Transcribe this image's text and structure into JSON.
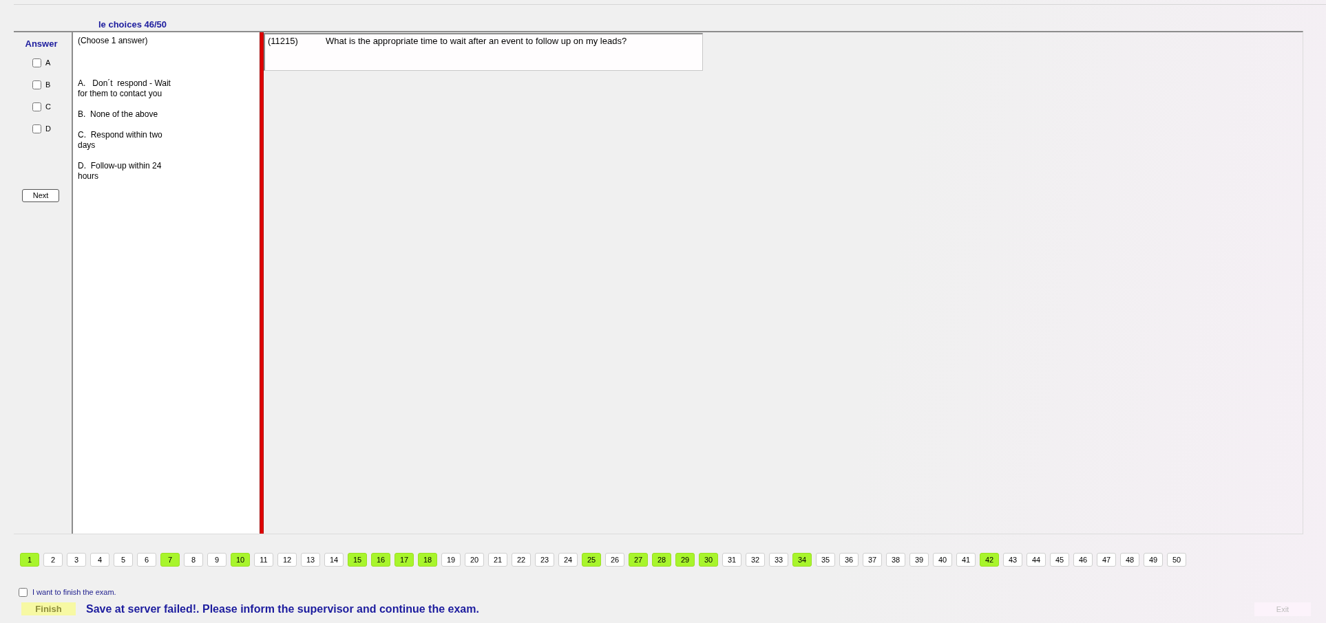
{
  "header": {
    "title": "le choices 46/50"
  },
  "answer_panel": {
    "heading": "Answer",
    "options": [
      {
        "label": "A",
        "checked": false
      },
      {
        "label": "B",
        "checked": false
      },
      {
        "label": "C",
        "checked": false
      },
      {
        "label": "D",
        "checked": false
      }
    ],
    "next_button": "Next"
  },
  "choices_panel": {
    "instruction": "(Choose 1 answer)",
    "choices": [
      "A.   Don´t  respond - Wait for them to contact you",
      "B.  None of the above",
      "C.  Respond within two days",
      "D.  Follow-up within 24 hours"
    ]
  },
  "question": {
    "number": "(11215)",
    "text": "What is the appropriate time to wait after an event to follow up on my leads?"
  },
  "question_nav": [
    {
      "label": "1",
      "answered": true
    },
    {
      "label": "2",
      "answered": false
    },
    {
      "label": "3",
      "answered": false
    },
    {
      "label": "4",
      "answered": false
    },
    {
      "label": "5",
      "answered": false
    },
    {
      "label": "6",
      "answered": false
    },
    {
      "label": "7",
      "answered": true
    },
    {
      "label": "8",
      "answered": false
    },
    {
      "label": "9",
      "answered": false
    },
    {
      "label": "10",
      "answered": true
    },
    {
      "label": "11",
      "answered": false
    },
    {
      "label": "12",
      "answered": false
    },
    {
      "label": "13",
      "answered": false
    },
    {
      "label": "14",
      "answered": false
    },
    {
      "label": "15",
      "answered": true
    },
    {
      "label": "16",
      "answered": true
    },
    {
      "label": "17",
      "answered": true
    },
    {
      "label": "18",
      "answered": true
    },
    {
      "label": "19",
      "answered": false
    },
    {
      "label": "20",
      "answered": false
    },
    {
      "label": "21",
      "answered": false
    },
    {
      "label": "22",
      "answered": false
    },
    {
      "label": "23",
      "answered": false
    },
    {
      "label": "24",
      "answered": false
    },
    {
      "label": "25",
      "answered": true
    },
    {
      "label": "26",
      "answered": false
    },
    {
      "label": "27",
      "answered": true
    },
    {
      "label": "28",
      "answered": true
    },
    {
      "label": "29",
      "answered": true
    },
    {
      "label": "30",
      "answered": true
    },
    {
      "label": "31",
      "answered": false
    },
    {
      "label": "32",
      "answered": false
    },
    {
      "label": "33",
      "answered": false
    },
    {
      "label": "34",
      "answered": true
    },
    {
      "label": "35",
      "answered": false
    },
    {
      "label": "36",
      "answered": false
    },
    {
      "label": "37",
      "answered": false
    },
    {
      "label": "38",
      "answered": false
    },
    {
      "label": "39",
      "answered": false
    },
    {
      "label": "40",
      "answered": false
    },
    {
      "label": "41",
      "answered": false
    },
    {
      "label": "42",
      "answered": true
    },
    {
      "label": "43",
      "answered": false
    },
    {
      "label": "44",
      "answered": false
    },
    {
      "label": "45",
      "answered": false
    },
    {
      "label": "46",
      "answered": false
    },
    {
      "label": "47",
      "answered": false
    },
    {
      "label": "48",
      "answered": false
    },
    {
      "label": "49",
      "answered": false
    },
    {
      "label": "50",
      "answered": false
    }
  ],
  "footer": {
    "finish_checkbox": {
      "label": "I want to finish the exam.",
      "checked": false
    },
    "finish_button": "Finish",
    "message": "Save at server failed!. Please inform the supervisor and continue the exam.",
    "exit_button": {
      "label": "Exit",
      "disabled": true
    }
  }
}
